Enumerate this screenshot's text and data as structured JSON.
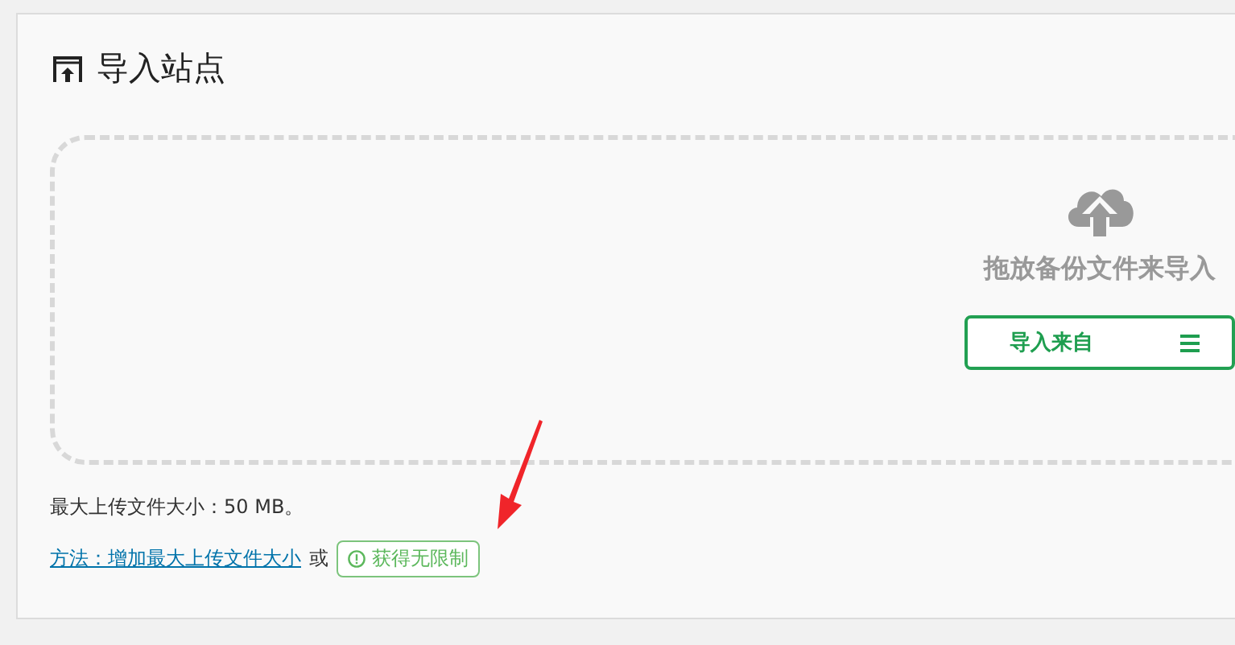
{
  "panel": {
    "title": "导入站点"
  },
  "dropzone": {
    "prompt": "拖放备份文件来导入",
    "import_button": "导入来自"
  },
  "max_upload": "最大上传文件大小：50 MB。",
  "help": {
    "link": "方法：增加最大上传文件大小",
    "separator": "或",
    "badge": "获得无限制"
  }
}
